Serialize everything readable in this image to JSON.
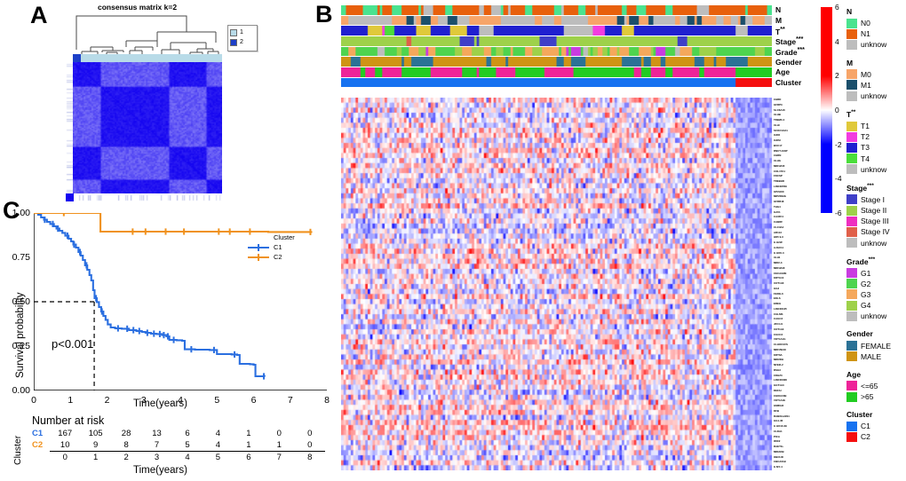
{
  "figure": {
    "panels": [
      "A",
      "B",
      "C"
    ]
  },
  "panel_a": {
    "letter": "A",
    "title": "consensus matrix k=2",
    "legend": [
      {
        "label": "1",
        "color": "#b8dbe8"
      },
      {
        "label": "2",
        "color": "#1d40c8"
      }
    ],
    "matrix_color": "#1404f0"
  },
  "panel_b": {
    "letter": "B",
    "annotation_rows": [
      {
        "name": "N",
        "sup": "",
        "key": "N"
      },
      {
        "name": "M",
        "sup": "",
        "key": "M"
      },
      {
        "name": "T",
        "sup": "**",
        "key": "T"
      },
      {
        "name": "Stage",
        "sup": "***",
        "key": "Stage"
      },
      {
        "name": "Grade",
        "sup": "***",
        "key": "Grade"
      },
      {
        "name": "Gender",
        "sup": "",
        "key": "Gender"
      },
      {
        "name": "Age",
        "sup": "",
        "key": "Age"
      },
      {
        "name": "Cluster",
        "sup": "",
        "key": "Cluster"
      }
    ],
    "colorbar": {
      "ticks": [
        "6",
        "4",
        "2",
        "0",
        "-2",
        "-4",
        "-6"
      ],
      "max": 6,
      "min": -6,
      "high_color": "#ff0000",
      "mid_color": "#ffffff",
      "low_color": "#0000ff"
    },
    "legends": [
      {
        "title": "N",
        "sup": "",
        "items": [
          {
            "label": "N0",
            "color": "#4ae38f"
          },
          {
            "label": "N1",
            "color": "#e8600c"
          },
          {
            "label": "unknow",
            "color": "#bdbdbd"
          }
        ]
      },
      {
        "title": "M",
        "sup": "",
        "items": [
          {
            "label": "M0",
            "color": "#f7a569"
          },
          {
            "label": "M1",
            "color": "#1b4f6b"
          },
          {
            "label": "unknow",
            "color": "#bdbdbd"
          }
        ]
      },
      {
        "title": "T",
        "sup": "**",
        "items": [
          {
            "label": "T1",
            "color": "#e0c93a"
          },
          {
            "label": "T2",
            "color": "#f23ce0"
          },
          {
            "label": "T3",
            "color": "#2020d0"
          },
          {
            "label": "T4",
            "color": "#4ade3a"
          },
          {
            "label": "unknow",
            "color": "#bdbdbd"
          }
        ]
      },
      {
        "title": "Stage",
        "sup": "***",
        "items": [
          {
            "label": "Stage I",
            "color": "#3f3fc8"
          },
          {
            "label": "Stage II",
            "color": "#9ed14a"
          },
          {
            "label": "Stage III",
            "color": "#ee2ec0"
          },
          {
            "label": "Stage IV",
            "color": "#e0604a"
          },
          {
            "label": "unknow",
            "color": "#bdbdbd"
          }
        ]
      },
      {
        "title": "Grade",
        "sup": "***",
        "items": [
          {
            "label": "G1",
            "color": "#c93ce0"
          },
          {
            "label": "G2",
            "color": "#4fd44f"
          },
          {
            "label": "G3",
            "color": "#f5a85c"
          },
          {
            "label": "G4",
            "color": "#9ed14a"
          },
          {
            "label": "unknow",
            "color": "#bdbdbd"
          }
        ]
      },
      {
        "title": "Gender",
        "sup": "",
        "items": [
          {
            "label": "FEMALE",
            "color": "#2b7296"
          },
          {
            "label": "MALE",
            "color": "#cf9414"
          }
        ]
      },
      {
        "title": "Age",
        "sup": "",
        "items": [
          {
            "label": "<=65",
            "color": "#ee2398"
          },
          {
            "label": ">65",
            "color": "#22cc22"
          }
        ]
      },
      {
        "title": "Cluster",
        "sup": "",
        "items": [
          {
            "label": "C1",
            "color": "#1772f0"
          },
          {
            "label": "C2",
            "color": "#f50f0f"
          }
        ]
      }
    ],
    "gene_labels": [
      "CHRD",
      "GFRP3",
      "SLC6A16",
      "XLHB",
      "TRB2D-4",
      "XLHI",
      "SCO3 E4A1",
      "IADO",
      "IADSI",
      "BUC17",
      "RNUT-103P",
      "CHRN",
      "XLHG",
      "MIR12C8",
      "COL1TA1",
      "FDCSP",
      "TREBHD",
      "LINC00559",
      "GP2HXX",
      "MIP2DIHG",
      "GFRR18",
      "THG4",
      "GAV1",
      "CA3FF4",
      "CABRF",
      "CLC3A4",
      "AR113",
      "HD5 9-3",
      "G H2JF",
      "AJGC11",
      "G HO0-3",
      "XLH1",
      "MIR2-3",
      "MIR12G8",
      "CECAGRE",
      "KRT1C3",
      "UOT1A6",
      "GG3",
      "FER1L6",
      "EDLS",
      "EREG",
      "LINC00125",
      "CGLMS",
      "CAGC3",
      "JFO H1",
      "UOT1A3",
      "CGCC3",
      "VOT1A1G",
      "CLHOO1VS",
      "MIR15E4X",
      "KRT6A",
      "MIR2DH",
      "NFE2L2",
      "RSG3",
      "CDHZ3",
      "LINC00308",
      "GGT1A3",
      "DEFAI",
      "CHOGC3B",
      "VOT1A1E",
      "GM66J3",
      "DFB",
      "RABOH+NS1",
      "GG1-36",
      "G HO10-39",
      "CLDA1",
      "PICA",
      "IRIC2",
      "RAET1L",
      "MIRADB",
      "OBCU3I",
      "CBCA01B",
      "G MY-4"
    ]
  },
  "panel_c": {
    "letter": "C",
    "ylabel": "Survival probability",
    "xlabel": "Time(years)",
    "pvalue": "p<0.001",
    "legend_title": "Cluster",
    "median_line": {
      "x": 1.65,
      "y": 0.5
    },
    "risk_title": "Number at risk",
    "risk_side_label": "Cluster",
    "risk_xlabel": "Time(years)",
    "risk_axis": [
      "0",
      "1",
      "2",
      "3",
      "4",
      "5",
      "6",
      "7",
      "8"
    ],
    "risk_rows": [
      {
        "label": "C1",
        "color": "#2b6fe0",
        "values": [
          "167",
          "105",
          "28",
          "13",
          "6",
          "4",
          "1",
          "0",
          "0"
        ]
      },
      {
        "label": "C2",
        "color": "#f0921e",
        "values": [
          "10",
          "9",
          "8",
          "7",
          "5",
          "4",
          "1",
          "1",
          "0"
        ]
      }
    ],
    "ylim": [
      0,
      1
    ],
    "xlim": [
      0,
      8
    ],
    "yticks": [
      "0.00",
      "0.25",
      "0.50",
      "0.75",
      "1.00"
    ],
    "xticks": [
      "0",
      "1",
      "2",
      "3",
      "4",
      "5",
      "6",
      "7",
      "8"
    ]
  },
  "chart_data": [
    {
      "type": "line",
      "name": "panel-c-kaplan-meier",
      "title": "",
      "xlabel": "Time(years)",
      "ylabel": "Survival probability",
      "xlim": [
        0,
        8
      ],
      "ylim": [
        0,
        1
      ],
      "grid": false,
      "legend_position": "right",
      "annotations": [
        "p<0.001"
      ],
      "series": [
        {
          "name": "C1",
          "color": "#2b6fe0",
          "points": [
            [
              0.0,
              1.0
            ],
            [
              0.12,
              0.99
            ],
            [
              0.2,
              0.975
            ],
            [
              0.28,
              0.962
            ],
            [
              0.36,
              0.95
            ],
            [
              0.45,
              0.938
            ],
            [
              0.55,
              0.925
            ],
            [
              0.62,
              0.912
            ],
            [
              0.7,
              0.9
            ],
            [
              0.78,
              0.888
            ],
            [
              0.86,
              0.872
            ],
            [
              0.95,
              0.855
            ],
            [
              1.02,
              0.84
            ],
            [
              1.08,
              0.822
            ],
            [
              1.15,
              0.805
            ],
            [
              1.22,
              0.78
            ],
            [
              1.28,
              0.76
            ],
            [
              1.34,
              0.735
            ],
            [
              1.4,
              0.705
            ],
            [
              1.46,
              0.68
            ],
            [
              1.52,
              0.65
            ],
            [
              1.57,
              0.62
            ],
            [
              1.62,
              0.565
            ],
            [
              1.66,
              0.52
            ],
            [
              1.72,
              0.498
            ],
            [
              1.78,
              0.47
            ],
            [
              1.84,
              0.445
            ],
            [
              1.9,
              0.42
            ],
            [
              1.96,
              0.398
            ],
            [
              2.02,
              0.372
            ],
            [
              2.1,
              0.355
            ],
            [
              2.22,
              0.35
            ],
            [
              2.4,
              0.348
            ],
            [
              2.6,
              0.34
            ],
            [
              2.8,
              0.335
            ],
            [
              2.95,
              0.33
            ],
            [
              3.05,
              0.325
            ],
            [
              3.2,
              0.32
            ],
            [
              3.35,
              0.318
            ],
            [
              3.5,
              0.312
            ],
            [
              3.62,
              0.305
            ],
            [
              3.7,
              0.285
            ],
            [
              3.9,
              0.283
            ],
            [
              4.05,
              0.28
            ],
            [
              4.12,
              0.232
            ],
            [
              4.4,
              0.23
            ],
            [
              4.8,
              0.228
            ],
            [
              5.0,
              0.205
            ],
            [
              5.4,
              0.203
            ],
            [
              5.55,
              0.2
            ],
            [
              5.62,
              0.15
            ],
            [
              5.9,
              0.148
            ],
            [
              6.0,
              0.145
            ],
            [
              6.05,
              0.08
            ],
            [
              6.3,
              0.078
            ]
          ],
          "censor_x": [
            0.3,
            0.52,
            0.66,
            0.92,
            1.1,
            1.26,
            1.44,
            1.7,
            1.86,
            2.3,
            2.55,
            2.72,
            2.88,
            3.1,
            3.28,
            3.44,
            3.55,
            3.66,
            3.82,
            4.3,
            4.92,
            5.48,
            6.28
          ]
        },
        {
          "name": "C2",
          "color": "#f0921e",
          "points": [
            [
              0.0,
              1.0
            ],
            [
              0.8,
              1.0
            ],
            [
              1.8,
              1.0
            ],
            [
              1.82,
              0.895
            ],
            [
              6.4,
              0.893
            ],
            [
              7.6,
              0.893
            ]
          ],
          "censor_x": [
            0.82,
            2.7,
            3.05,
            3.6,
            4.1,
            5.05,
            5.35,
            5.9,
            7.55
          ]
        }
      ],
      "risk_table": {
        "times": [
          0,
          1,
          2,
          3,
          4,
          5,
          6,
          7,
          8
        ],
        "rows": [
          {
            "name": "C1",
            "counts": [
              167,
              105,
              28,
              13,
              6,
              4,
              1,
              0,
              0
            ]
          },
          {
            "name": "C2",
            "counts": [
              10,
              9,
              8,
              7,
              5,
              4,
              1,
              1,
              0
            ]
          }
        ]
      }
    },
    {
      "type": "heatmap",
      "name": "panel-b-expression-heatmap",
      "title": "",
      "colorbar_range": [
        -6,
        6
      ],
      "colorbar_ticks": [
        6,
        4,
        2,
        0,
        -2,
        -4,
        -6
      ],
      "colormap": [
        "#0000ff",
        "#ffffff",
        "#ff0000"
      ],
      "n_rows": 74,
      "n_cols": 178,
      "row_labels_key": "panel_b.gene_labels",
      "column_annotations": [
        "N",
        "M",
        "T**",
        "Stage***",
        "Grade***",
        "Gender",
        "Age",
        "Cluster"
      ]
    },
    {
      "type": "heatmap",
      "name": "panel-a-consensus-matrix",
      "title": "consensus matrix k=2",
      "colormap": [
        "#ffffff",
        "#1404f0"
      ],
      "k": 2,
      "clusters": [
        {
          "label": "1",
          "color": "#b8dbe8"
        },
        {
          "label": "2",
          "color": "#1d40c8"
        }
      ]
    }
  ]
}
